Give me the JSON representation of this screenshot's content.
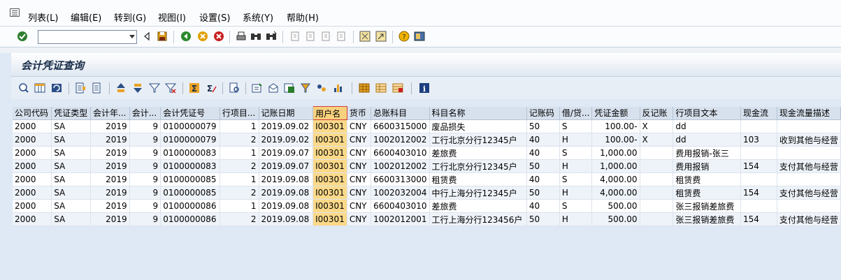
{
  "menu": {
    "items": [
      "列表(L)",
      "编辑(E)",
      "转到(G)",
      "视图(I)",
      "设置(S)",
      "系统(Y)",
      "帮助(H)"
    ]
  },
  "toolbar": {
    "command_value": ""
  },
  "title": "会计凭证查询",
  "grid": {
    "columns": [
      "公司代码",
      "凭证类型",
      "会计年...",
      "会计...",
      "会计凭证号",
      "行项目...",
      "记账日期",
      "用户名",
      "货币",
      "总账科目",
      "科目名称",
      "记账码",
      "借/贷...",
      "凭证金额",
      "反记账",
      "行项目文本",
      "现金流",
      "现金流量描述"
    ],
    "rows": [
      [
        "2000",
        "SA",
        "2019",
        "9",
        "0100000079",
        "1",
        "2019.09.02",
        "I00301",
        "CNY",
        "6600315000",
        "废品损失",
        "50",
        "S",
        "100.00-",
        "X",
        "dd",
        "",
        ""
      ],
      [
        "2000",
        "SA",
        "2019",
        "9",
        "0100000079",
        "2",
        "2019.09.02",
        "I00301",
        "CNY",
        "1002012002",
        "工行北京分行12345户",
        "40",
        "H",
        "100.00-",
        "X",
        "dd",
        "103",
        "收到其他与经营"
      ],
      [
        "2000",
        "SA",
        "2019",
        "9",
        "0100000083",
        "1",
        "2019.09.07",
        "I00301",
        "CNY",
        "6600403010",
        "差旅费",
        "40",
        "S",
        "1,000.00",
        "",
        "费用报销-张三",
        "",
        ""
      ],
      [
        "2000",
        "SA",
        "2019",
        "9",
        "0100000083",
        "2",
        "2019.09.07",
        "I00301",
        "CNY",
        "1002012002",
        "工行北京分行12345户",
        "50",
        "H",
        "1,000.00",
        "",
        "费用报销",
        "154",
        "支付其他与经营"
      ],
      [
        "2000",
        "SA",
        "2019",
        "9",
        "0100000085",
        "1",
        "2019.09.08",
        "I00301",
        "CNY",
        "6600313000",
        "租赁费",
        "40",
        "S",
        "4,000.00",
        "",
        "租赁费",
        "",
        ""
      ],
      [
        "2000",
        "SA",
        "2019",
        "9",
        "0100000085",
        "2",
        "2019.09.08",
        "I00301",
        "CNY",
        "1002032004",
        "中行上海分行12345户",
        "50",
        "H",
        "4,000.00",
        "",
        "租赁费",
        "154",
        "支付其他与经营"
      ],
      [
        "2000",
        "SA",
        "2019",
        "9",
        "0100000086",
        "1",
        "2019.09.08",
        "I00301",
        "CNY",
        "6600403010",
        "差旅费",
        "40",
        "S",
        "500.00",
        "",
        "张三报销差旅费",
        "",
        ""
      ],
      [
        "2000",
        "SA",
        "2019",
        "9",
        "0100000086",
        "2",
        "2019.09.08",
        "I00301",
        "CNY",
        "1002012001",
        "工行上海分行123456户",
        "50",
        "H",
        "500.00",
        "",
        "张三报销差旅费",
        "154",
        "支付其他与经营"
      ]
    ]
  },
  "icons": {
    "toolbar": [
      "check-icon",
      "back-icon",
      "save-icon",
      "back-nav-icon",
      "exit-icon",
      "cancel-icon",
      "print-icon",
      "find-icon",
      "find-next-icon",
      "first-page-icon",
      "prev-page-icon",
      "next-page-icon",
      "last-page-icon",
      "create-session-icon",
      "shortcut-icon",
      "help-icon",
      "layout-icon"
    ],
    "alv": [
      "details-icon",
      "column-layout-icon",
      "refresh-icon",
      "select-all-icon",
      "deselect-all-icon",
      "sort-asc-icon",
      "sort-desc-icon",
      "filter-icon",
      "delete-filter-icon",
      "sum-icon",
      "subtotal-icon",
      "print-preview-icon",
      "export-icon",
      "mail-icon",
      "spreadsheet-icon",
      "abc-analysis-icon",
      "graphic-icon",
      "choose-layout-icon",
      "change-layout-icon",
      "save-layout-icon",
      "info-icon"
    ]
  }
}
